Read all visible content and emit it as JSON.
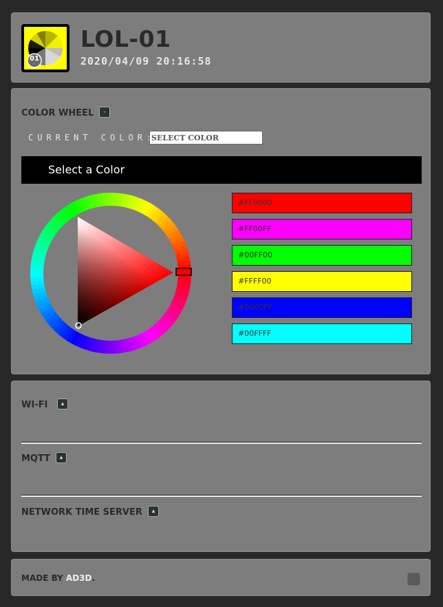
{
  "header": {
    "device_name": "LOL-01",
    "datetime": "2020/04/09 20:16:58",
    "logo_badge": "01"
  },
  "color_wheel": {
    "title": "COLOR WHEEL",
    "toggle_icon": "collapse-icon",
    "current_color_label": "CURRENT COLOR:",
    "current_color_value": "SELECT COLOR",
    "select_bar_text": "Select a Color",
    "selected_hue": "#FF0000",
    "swatches": [
      {
        "label": "#FF0000",
        "color": "#ff0000"
      },
      {
        "label": "#FF00FF",
        "color": "#ff00ff"
      },
      {
        "label": "#00FF00",
        "color": "#00ff00"
      },
      {
        "label": "#FFFF00",
        "color": "#ffff00"
      },
      {
        "label": "#0000FF",
        "color": "#0000ff"
      },
      {
        "label": "#00FFFF",
        "color": "#00ffff"
      }
    ]
  },
  "network": {
    "wifi_title": "WI-FI",
    "mqtt_title": "MQTT",
    "ntp_title": "NETWORK TIME SERVER",
    "toggle_icon": "expand-icon"
  },
  "footer": {
    "made_by": "MADE BY ",
    "brand": "AD3D",
    "suffix": "."
  },
  "colors": {
    "background": "#282828",
    "panel": "#7d7d7d",
    "logo_yellow": "#ffff00"
  }
}
